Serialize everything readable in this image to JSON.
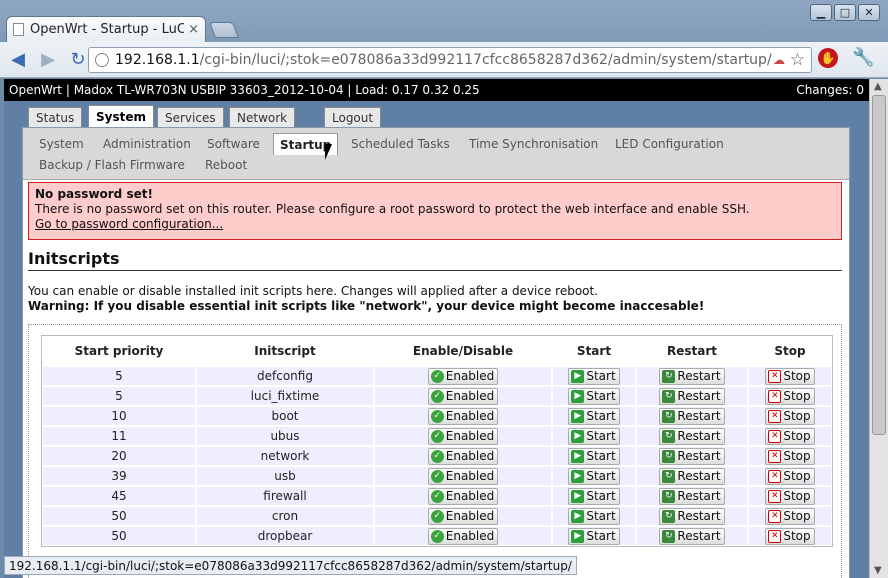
{
  "browser": {
    "tab_title": "OpenWrt - Startup - LuCI",
    "tab_close": "×",
    "url_host": "192.168.1.1",
    "url_path": "/cgi-bin/luci/;stok=e078086a33d992117cfcc8658287d362/admin/system/startup/",
    "status_url": "192.168.1.1/cgi-bin/luci/;stok=e078086a33d992117cfcc8658287d362/admin/system/startup/"
  },
  "header": {
    "left": "OpenWrt | Madox TL-WR703N USBIP 33603_2012-10-04 | Load: 0.17 0.32 0.25",
    "right": "Changes: 0"
  },
  "main_tabs": [
    "Status",
    "System",
    "Services",
    "Network",
    "Logout"
  ],
  "sub_tabs": [
    "System",
    "Administration",
    "Software",
    "Startup",
    "Scheduled Tasks",
    "Time Synchronisation",
    "LED Configuration",
    "Backup / Flash Firmware",
    "Reboot"
  ],
  "alert": {
    "title": "No password set!",
    "text": "There is no password set on this router. Please configure a root password to protect the web interface and enable SSH.",
    "link": "Go to password configuration..."
  },
  "section": {
    "title": "Initscripts",
    "desc": "You can enable or disable installed init scripts here. Changes will applied after a device reboot.",
    "warning": "Warning: If you disable essential init scripts like \"network\", your device might become inaccesable!"
  },
  "table": {
    "headers": [
      "Start priority",
      "Initscript",
      "Enable/Disable",
      "Start",
      "Restart",
      "Stop"
    ],
    "enable_label": "Enabled",
    "start_label": "Start",
    "restart_label": "Restart",
    "stop_label": "Stop",
    "rows": [
      {
        "priority": "5",
        "name": "defconfig"
      },
      {
        "priority": "5",
        "name": "luci_fixtime"
      },
      {
        "priority": "10",
        "name": "boot"
      },
      {
        "priority": "11",
        "name": "ubus"
      },
      {
        "priority": "20",
        "name": "network"
      },
      {
        "priority": "39",
        "name": "usb"
      },
      {
        "priority": "45",
        "name": "firewall"
      },
      {
        "priority": "50",
        "name": "cron"
      },
      {
        "priority": "50",
        "name": "dropbear"
      }
    ]
  }
}
